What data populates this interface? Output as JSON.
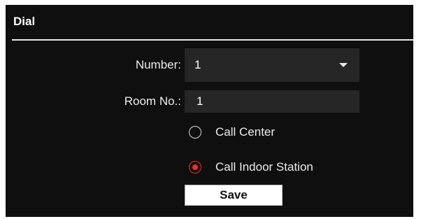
{
  "section": {
    "title": "Dial"
  },
  "form": {
    "number": {
      "label": "Number:",
      "value": "1"
    },
    "room_no": {
      "label": "Room No.:",
      "value": "1"
    },
    "call_target": {
      "options": [
        {
          "label": "Call Center",
          "selected": false
        },
        {
          "label": "Call Indoor Station",
          "selected": true
        }
      ]
    },
    "save_label": "Save"
  },
  "colors": {
    "panel_background": "#0f0f0f",
    "field_background": "#262626",
    "accent_selected": "#e8312a",
    "divider": "#e6e6e6"
  },
  "icons": {
    "dropdown": "chevron-down-icon",
    "radio_unchecked": "radio-unchecked-icon",
    "radio_checked": "radio-checked-icon"
  }
}
